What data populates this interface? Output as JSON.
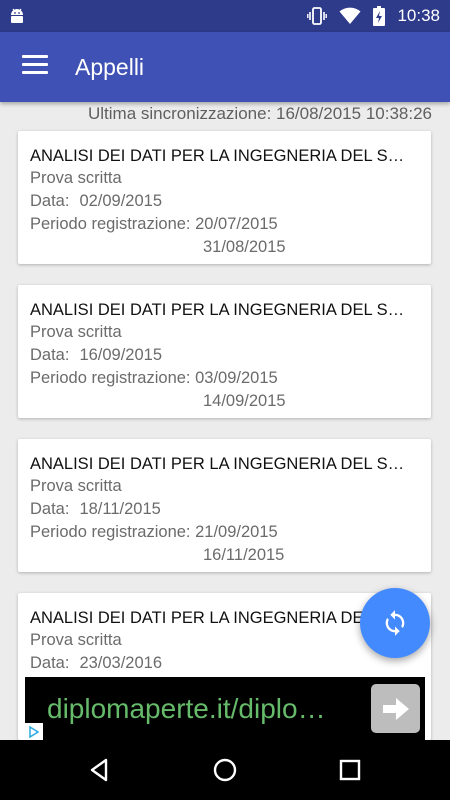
{
  "status_bar": {
    "time": "10:38",
    "icons": [
      "android-icon",
      "vibrate-icon",
      "wifi-icon",
      "battery-icon"
    ]
  },
  "app_bar": {
    "title": "Appelli",
    "menu_icon": "hamburger-menu-icon"
  },
  "sync": {
    "text": "Ultima sincronizzazione: 16/08/2015 10:38:26"
  },
  "exams": [
    {
      "title": "ANALISI DEI DATI PER LA INGEGNERIA DEL SOFTWARE",
      "type": "Prova scritta",
      "date_label": "Data:",
      "date": "02/09/2015",
      "reg_label": "Periodo registrazione:",
      "reg_start": "20/07/2015",
      "reg_end": "31/08/2015"
    },
    {
      "title": "ANALISI DEI DATI PER LA INGEGNERIA DEL SOFTWARE",
      "type": "Prova scritta",
      "date_label": "Data:",
      "date": "16/09/2015",
      "reg_label": "Periodo registrazione:",
      "reg_start": "03/09/2015",
      "reg_end": "14/09/2015"
    },
    {
      "title": "ANALISI DEI DATI PER LA INGEGNERIA DEL SOFTWARE",
      "type": "Prova scritta",
      "date_label": "Data:",
      "date": "18/11/2015",
      "reg_label": "Periodo registrazione:",
      "reg_start": "21/09/2015",
      "reg_end": "16/11/2015"
    },
    {
      "title": "ANALISI DEI DATI PER LA INGEGNERIA DEL SOFTWARE",
      "type": "Prova scritta",
      "date_label": "Data:",
      "date": "23/03/2016"
    }
  ],
  "fab": {
    "icon": "sync-icon",
    "color": "#448aff"
  },
  "ad": {
    "text": "diplomaperte.it/diplo…",
    "arrow_icon": "arrow-right-icon",
    "choices_icon": "adchoices-icon"
  },
  "nav_bar": {
    "icons": [
      "back-icon",
      "home-icon",
      "recents-icon"
    ]
  },
  "colors": {
    "primary": "#3f51b5",
    "primary_dark": "#2e3a8a",
    "accent": "#448aff",
    "ad_text": "#66bb6a"
  }
}
